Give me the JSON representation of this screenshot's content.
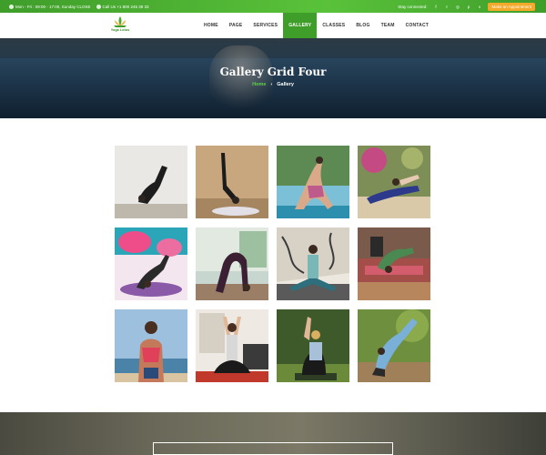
{
  "topbar": {
    "hours": "Mon - Fri : 09:00 - 17:00, Sunday CLOSE",
    "phone": "Call Us +1 800 245 39 33",
    "stay_connected": "Stay connected:",
    "appointment_button": "Make an Appointment"
  },
  "header": {
    "logo_text": "Yoga Lotus",
    "nav": [
      {
        "label": "HOME"
      },
      {
        "label": "PAGE"
      },
      {
        "label": "SERVICES"
      },
      {
        "label": "GALLERY"
      },
      {
        "label": "CLASSES"
      },
      {
        "label": "BLOG"
      },
      {
        "label": "TEAM"
      },
      {
        "label": "CONTACT"
      }
    ]
  },
  "hero": {
    "title": "Gallery Grid Four",
    "breadcrumb_home": "Home",
    "breadcrumb_separator": "›",
    "breadcrumb_current": "Gallery"
  },
  "colors": {
    "brand_green": "#3f9d2a",
    "accent_orange": "#f4a92a"
  }
}
